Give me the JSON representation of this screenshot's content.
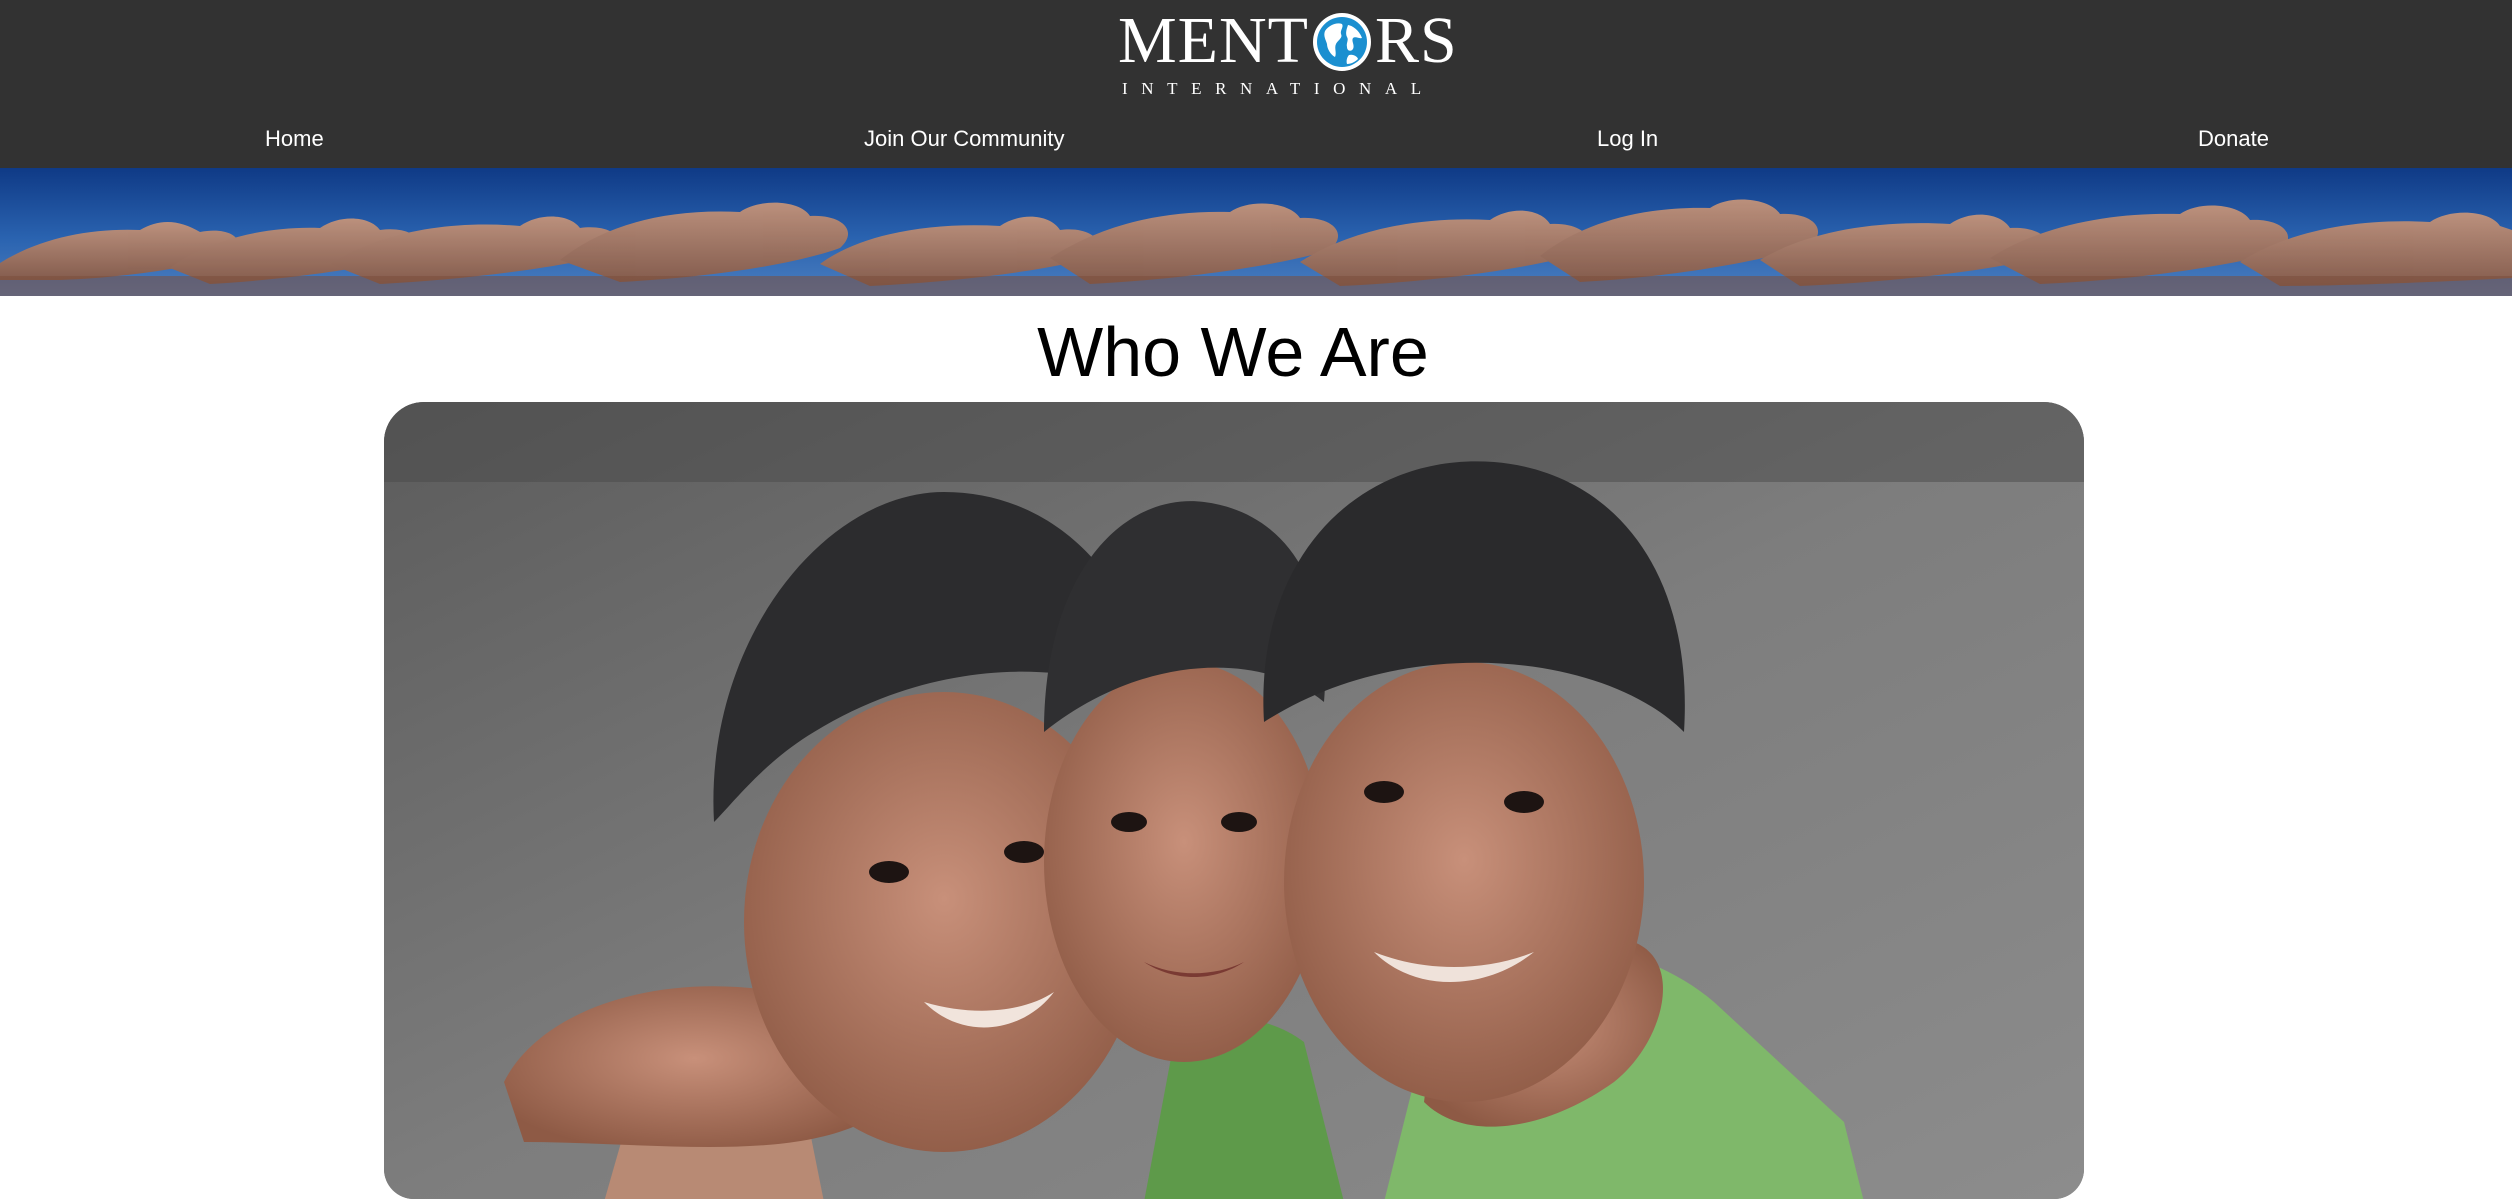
{
  "brand": {
    "word_left": "MENT",
    "word_right": "RS",
    "subtitle": "INTERNATIONAL",
    "globe_icon": "globe-icon",
    "accent_color": "#1b8fd0"
  },
  "nav": {
    "items": [
      {
        "label": "Home"
      },
      {
        "label": "Join Our Community"
      },
      {
        "label": "Log In"
      },
      {
        "label": "Donate"
      }
    ]
  },
  "banner": {
    "image": "raised-hands-banner"
  },
  "main": {
    "title": "Who We Are",
    "photo": "three-smiling-boys-photo"
  },
  "colors": {
    "header_bg": "#323232",
    "banner_sky": "#1f4f9a",
    "page_bg": "#ffffff"
  }
}
